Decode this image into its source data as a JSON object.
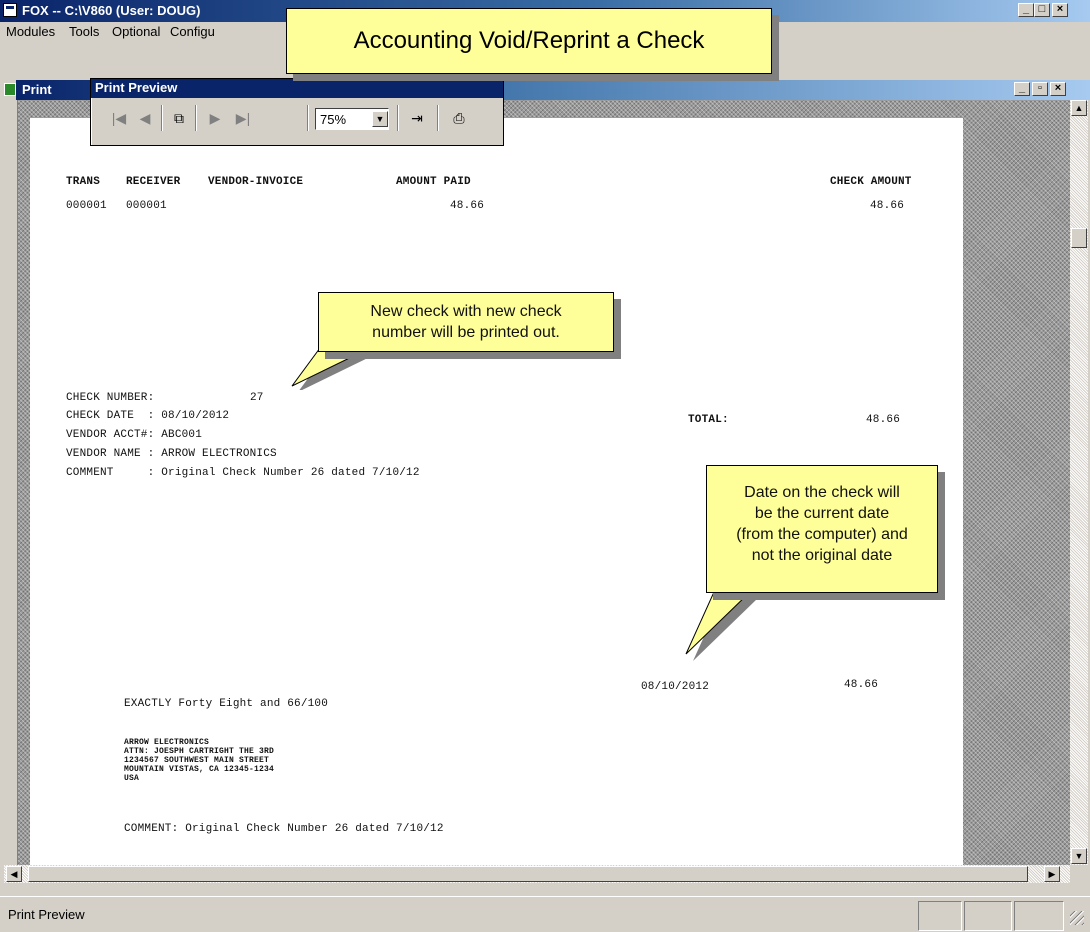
{
  "window": {
    "title": "FOX -- C:\\V860  (User: DOUG)"
  },
  "menu": {
    "items": [
      "Modules",
      "Tools",
      "Optional",
      "Configu"
    ]
  },
  "child_window": {
    "title": "Print"
  },
  "banner": {
    "text": "Accounting Void/Reprint a Check"
  },
  "print_preview": {
    "title": "Print Preview",
    "zoom_value": "75%"
  },
  "report": {
    "headers": {
      "trans": "TRANS",
      "receiver": "RECEIVER",
      "vendor_invoice": "VENDOR-INVOICE",
      "amount_paid": "AMOUNT PAID",
      "check_amount": "CHECK AMOUNT"
    },
    "row": {
      "trans": "000001",
      "receiver": "000001",
      "amount_paid": "48.66",
      "check_amount": "48.66"
    },
    "check_number_label": "CHECK NUMBER:",
    "check_number": "27",
    "check_date_line": "CHECK DATE  : 08/10/2012",
    "vendor_acct_line": "VENDOR ACCT#: ABC001",
    "vendor_name_line": "VENDOR NAME : ARROW ELECTRONICS",
    "comment_line": "COMMENT     : Original Check Number 26 dated 7/10/12",
    "total_label": "TOTAL:",
    "total_value": "48.66",
    "check_date": "08/10/2012",
    "check_amount": "48.66",
    "amount_words": "EXACTLY Forty Eight and 66/100",
    "address": [
      "ARROW ELECTRONICS",
      "ATTN: JOESPH CARTRIGHT THE 3RD",
      "1234567 SOUTHWEST MAIN STREET",
      "MOUNTAIN VISTAS, CA 12345-1234",
      "USA"
    ],
    "bottom_comment": "COMMENT: Original Check Number 26 dated 7/10/12"
  },
  "callouts": {
    "new_check": [
      "New check with new check",
      "number will be printed out."
    ],
    "date_note": [
      "Date on the check will",
      "be the current date",
      "(from the computer) and",
      "not the original date"
    ]
  },
  "status": {
    "text": "Print Preview"
  }
}
